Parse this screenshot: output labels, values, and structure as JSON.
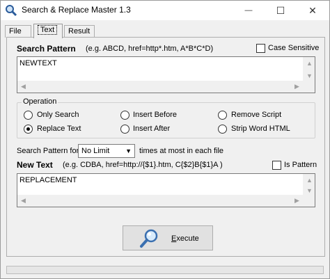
{
  "window": {
    "title": "Search & Replace Master 1.3",
    "controls": {
      "minimize": "—",
      "maximize": "☐",
      "close": "✕"
    }
  },
  "tabs": [
    {
      "label": "File"
    },
    {
      "label": "Text",
      "active": true
    },
    {
      "label": "Result"
    }
  ],
  "search_pattern": {
    "label": "Search Pattern",
    "hint": "(e.g.  ABCD, href=http*.htm, A*B*C*D)",
    "value": "NEWTEXT",
    "case_sensitive_label": "Case Sensitive",
    "case_sensitive_checked": false
  },
  "operation": {
    "title": "Operation",
    "options": [
      {
        "label": "Only Search",
        "checked": false
      },
      {
        "label": "Insert Before",
        "checked": false
      },
      {
        "label": "Remove Script",
        "checked": false
      },
      {
        "label": "Replace Text",
        "checked": true
      },
      {
        "label": "Insert After",
        "checked": false
      },
      {
        "label": "Strip Word HTML",
        "checked": false
      }
    ]
  },
  "limit": {
    "prefix": "Search Pattern for",
    "selected": "No Limit",
    "suffix": "times at most in each file"
  },
  "new_text": {
    "label": "New Text",
    "hint": "(e.g.   CDBA,  href=http://{$1}.htm,  C{$2}B{$1}A  )",
    "is_pattern_label": "Is Pattern",
    "is_pattern_checked": false,
    "value": "REPLACEMENT"
  },
  "execute": {
    "label_first": "E",
    "label_rest": "xecute"
  },
  "icons": [
    "app-magnifier-icon",
    "magnifier-icon",
    "scroll-arrow-icons"
  ]
}
